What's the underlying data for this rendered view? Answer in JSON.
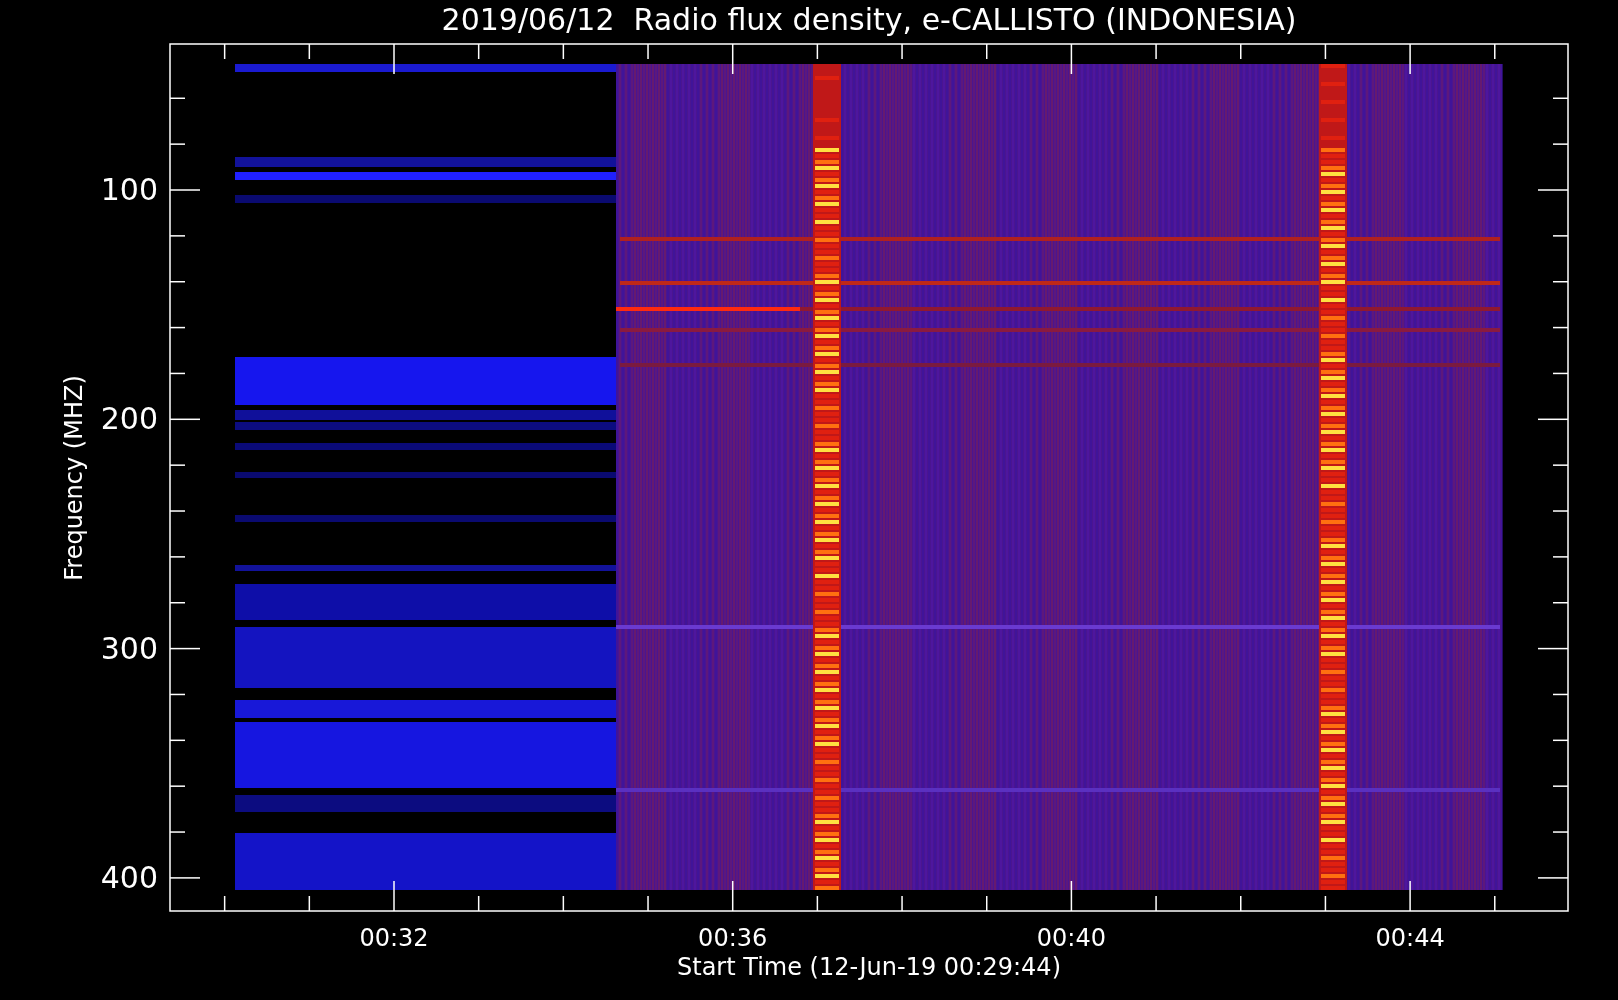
{
  "title": "2019/06/12  Radio flux density, e-CALLISTO (INDONESIA)",
  "y_axis": {
    "label": "Frequency (MHZ)",
    "ticks": [
      "100",
      "200",
      "300",
      "400"
    ]
  },
  "x_axis": {
    "label": "Start Time (12-Jun-19 00:29:44)",
    "ticks": [
      "00:32",
      "00:36",
      "00:40",
      "00:44"
    ]
  }
}
